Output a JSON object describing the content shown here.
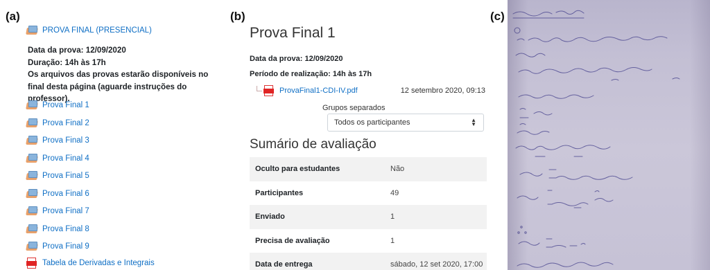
{
  "panels": {
    "a": "(a)",
    "b": "(b)",
    "c": "(c)"
  },
  "course_list": {
    "exam_link": "PROVA FINAL (PRESENCIAL)",
    "info": {
      "line1": "Data da prova: 12/09/2020",
      "line2": "Duração: 14h às 17h",
      "line3": "Os arquivos das provas estarão disponíveis no final desta página  (aguarde instruções do professor)."
    },
    "items": [
      {
        "label": "Prova Final 1",
        "icon": "assignment-icon"
      },
      {
        "label": "Prova Final 2",
        "icon": "assignment-icon"
      },
      {
        "label": "Prova Final 3",
        "icon": "assignment-icon"
      },
      {
        "label": "Prova Final 4",
        "icon": "assignment-icon"
      },
      {
        "label": "Prova Final 5",
        "icon": "assignment-icon"
      },
      {
        "label": "Prova Final 6",
        "icon": "assignment-icon"
      },
      {
        "label": "Prova Final 7",
        "icon": "assignment-icon"
      },
      {
        "label": "Prova Final 8",
        "icon": "assignment-icon"
      },
      {
        "label": "Prova Final 9",
        "icon": "assignment-icon"
      }
    ],
    "table_link": {
      "label": "Tabela de Derivadas e Integrais",
      "icon": "pdf-icon"
    }
  },
  "assignment": {
    "title": "Prova Final 1",
    "date_line": "Data da prova: 12/09/2020",
    "period_line": "Período de realização: 14h às 17h",
    "file": {
      "name": "ProvaFinal1-CDI-IV.pdf",
      "date": "12 setembro 2020, 09:13",
      "icon": "pdf-icon"
    },
    "groups_label": "Grupos separados",
    "groups_select": "Todos os participantes",
    "summary_heading": "Sumário de avaliação",
    "summary": [
      {
        "key": "Oculto para estudantes",
        "value": "Não"
      },
      {
        "key": "Participantes",
        "value": "49"
      },
      {
        "key": "Enviado",
        "value": "1"
      },
      {
        "key": "Precisa de avaliação",
        "value": "1"
      },
      {
        "key": "Data de entrega",
        "value": "sábado, 12 set 2020, 17:00"
      }
    ]
  },
  "colors": {
    "link": "#0f6fc5",
    "pdf_red": "#e02424",
    "table_stripe": "#f2f2f2",
    "paper": "#c8c4d8",
    "ink": "#3d3a8c"
  }
}
